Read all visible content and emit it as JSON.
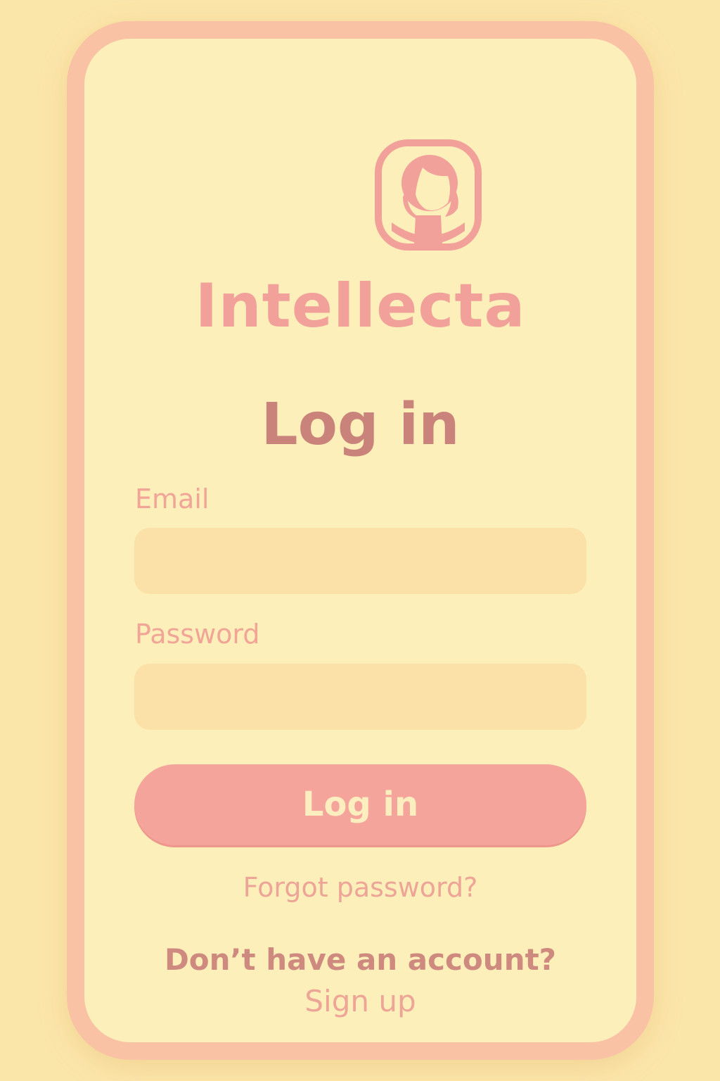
{
  "app": {
    "brand_name": "Intellecta",
    "logo_icon": "user-avatar-icon"
  },
  "screen": {
    "title": "Log in"
  },
  "form": {
    "email_label": "Email",
    "email_value": "",
    "email_placeholder": "",
    "password_label": "Password",
    "password_value": "",
    "password_placeholder": "",
    "submit_label": "Log in"
  },
  "links": {
    "forgot_password": "Forgot password?",
    "no_account_text": "Don’t have an account?",
    "sign_up": "Sign up"
  },
  "colors": {
    "background": "#fbe6a9",
    "card": "#fdefba",
    "border": "#f9c2a4",
    "accent": "#f4a49a",
    "heading": "#c9837b",
    "input_fill": "#fbe1a7"
  }
}
